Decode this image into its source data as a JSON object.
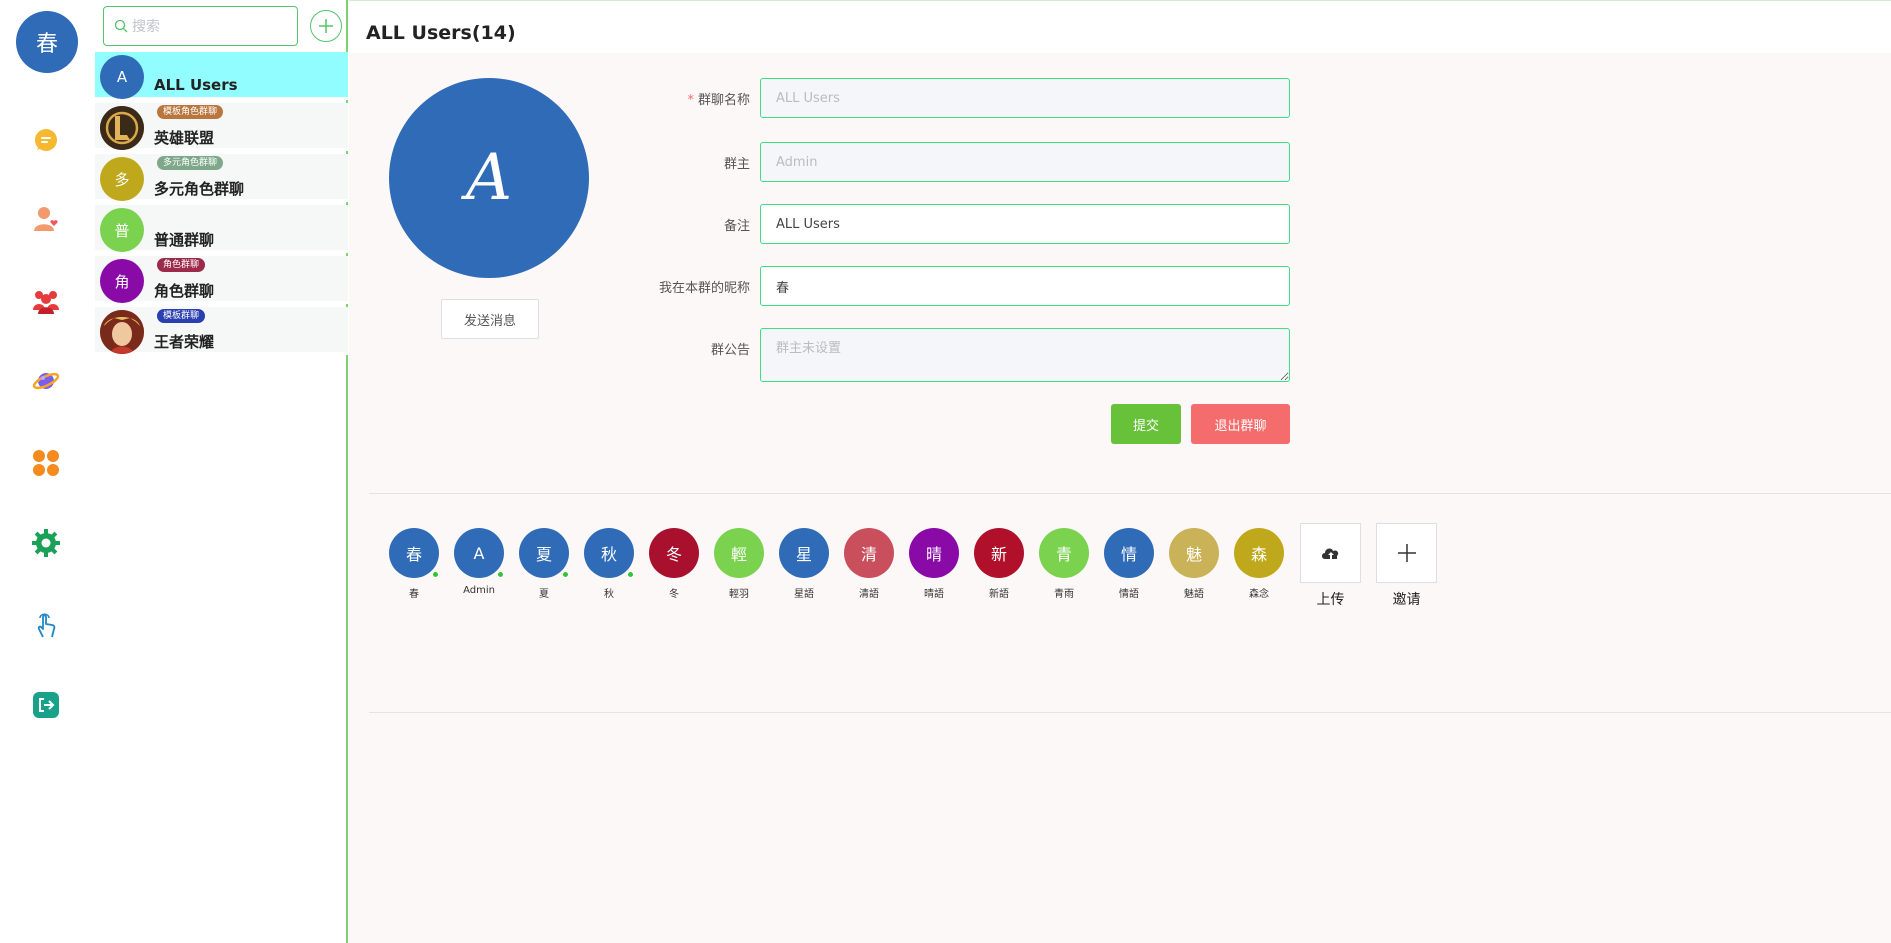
{
  "user": {
    "avatar_char": "春"
  },
  "nav": {
    "icons": [
      "chat-icon",
      "contacts-icon",
      "groups-icon",
      "planet-icon",
      "apps-icon",
      "settings-icon",
      "touch-icon",
      "logout-icon"
    ]
  },
  "search": {
    "placeholder": "搜索"
  },
  "conversations": [
    {
      "name": "ALL Users",
      "avatar_char": "A",
      "avatar_color": "#2f6bb6",
      "tag": "",
      "tag_color": "",
      "active": true
    },
    {
      "name": "英雄联盟",
      "avatar_char": "",
      "avatar_color": "#6b4a2a",
      "tag": "模板角色群聊",
      "tag_color": "#b9773f",
      "active": false
    },
    {
      "name": "多元角色群聊",
      "avatar_char": "多",
      "avatar_color": "#c0a81d",
      "tag": "多元角色群聊",
      "tag_color": "#7fa88a",
      "active": false
    },
    {
      "name": "普通群聊",
      "avatar_char": "普",
      "avatar_color": "#7bd24f",
      "tag": "",
      "tag_color": "",
      "active": false
    },
    {
      "name": "角色群聊",
      "avatar_char": "角",
      "avatar_color": "#8a0aa8",
      "tag": "角色群聊",
      "tag_color": "#9c2a4a",
      "active": false
    },
    {
      "name": "王者荣耀",
      "avatar_char": "",
      "avatar_color": "#a8462a",
      "tag": "模板群聊",
      "tag_color": "#2a3fb0",
      "active": false
    }
  ],
  "main": {
    "title": "ALL Users(14)",
    "group_avatar_char": "A",
    "send_button": "发送消息",
    "form": {
      "group_name_label": "群聊名称",
      "group_name_placeholder": "ALL Users",
      "owner_label": "群主",
      "owner_placeholder": "Admin",
      "remark_label": "备注",
      "remark_value": "ALL Users",
      "nickname_label": "我在本群的昵称",
      "nickname_value": "春",
      "notice_label": "群公告",
      "notice_placeholder": "群主未设置"
    },
    "submit_button": "提交",
    "quit_button": "退出群聊",
    "upload_label": "上传",
    "invite_label": "邀请"
  },
  "members": [
    {
      "char": "春",
      "name": "春",
      "color": "#2f6bb6",
      "online": true
    },
    {
      "char": "A",
      "name": "Admin",
      "color": "#2f6bb6",
      "online": true
    },
    {
      "char": "夏",
      "name": "夏",
      "color": "#2f6bb6",
      "online": true
    },
    {
      "char": "秋",
      "name": "秋",
      "color": "#2f6bb6",
      "online": true
    },
    {
      "char": "冬",
      "name": "冬",
      "color": "#a8102e",
      "online": false
    },
    {
      "char": "輕",
      "name": "輕羽",
      "color": "#7bd24f",
      "online": false
    },
    {
      "char": "星",
      "name": "星語",
      "color": "#2f6bb6",
      "online": false
    },
    {
      "char": "清",
      "name": "清語",
      "color": "#c94f5c",
      "online": false
    },
    {
      "char": "晴",
      "name": "晴語",
      "color": "#8a0aa8",
      "online": false
    },
    {
      "char": "新",
      "name": "新語",
      "color": "#b0102a",
      "online": false
    },
    {
      "char": "青",
      "name": "青雨",
      "color": "#7bd24f",
      "online": false
    },
    {
      "char": "情",
      "name": "情語",
      "color": "#2f6bb6",
      "online": false
    },
    {
      "char": "魅",
      "name": "魅語",
      "color": "#c9b257",
      "online": false
    },
    {
      "char": "森",
      "name": "森念",
      "color": "#c0a81d",
      "online": false
    }
  ]
}
